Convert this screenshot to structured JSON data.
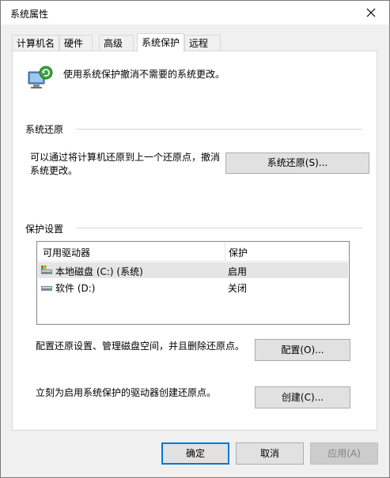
{
  "window": {
    "title": "系统属性",
    "close_icon": "close-icon"
  },
  "tabs": [
    {
      "label": "计算机名",
      "active": false
    },
    {
      "label": "硬件",
      "active": false
    },
    {
      "label": "高级",
      "active": false
    },
    {
      "label": "系统保护",
      "active": true
    },
    {
      "label": "远程",
      "active": false
    }
  ],
  "header": {
    "icon": "system-protection-icon",
    "text": "使用系统保护撤消不需要的系统更改。"
  },
  "system_restore": {
    "group_label": "系统还原",
    "description_line1": "可以通过将计算机还原到上一个还原点，撤消",
    "description_line2": "系统更改。",
    "button_label": "系统还原(S)..."
  },
  "protection_settings": {
    "group_label": "保护设置",
    "columns": [
      "可用驱动器",
      "保护"
    ],
    "drives": [
      {
        "name": "本地磁盘 (C:) (系统)",
        "protection": "启用",
        "icon": "system-drive-icon",
        "selected": true
      },
      {
        "name": "软件 (D:)",
        "protection": "关闭",
        "icon": "drive-icon",
        "selected": false
      }
    ],
    "configure_text": "配置还原设置、管理磁盘空间，并且删除还原点。",
    "configure_button": "配置(O)...",
    "create_text": "立刻为启用系统保护的驱动器创建还原点。",
    "create_button": "创建(C)..."
  },
  "footer": {
    "ok_label": "确定",
    "cancel_label": "取消",
    "apply_label": "应用(A)"
  },
  "colors": {
    "accent": "#0078d7",
    "selected_row": "#e5e5e5",
    "window_bg": "#f0f0f0"
  }
}
